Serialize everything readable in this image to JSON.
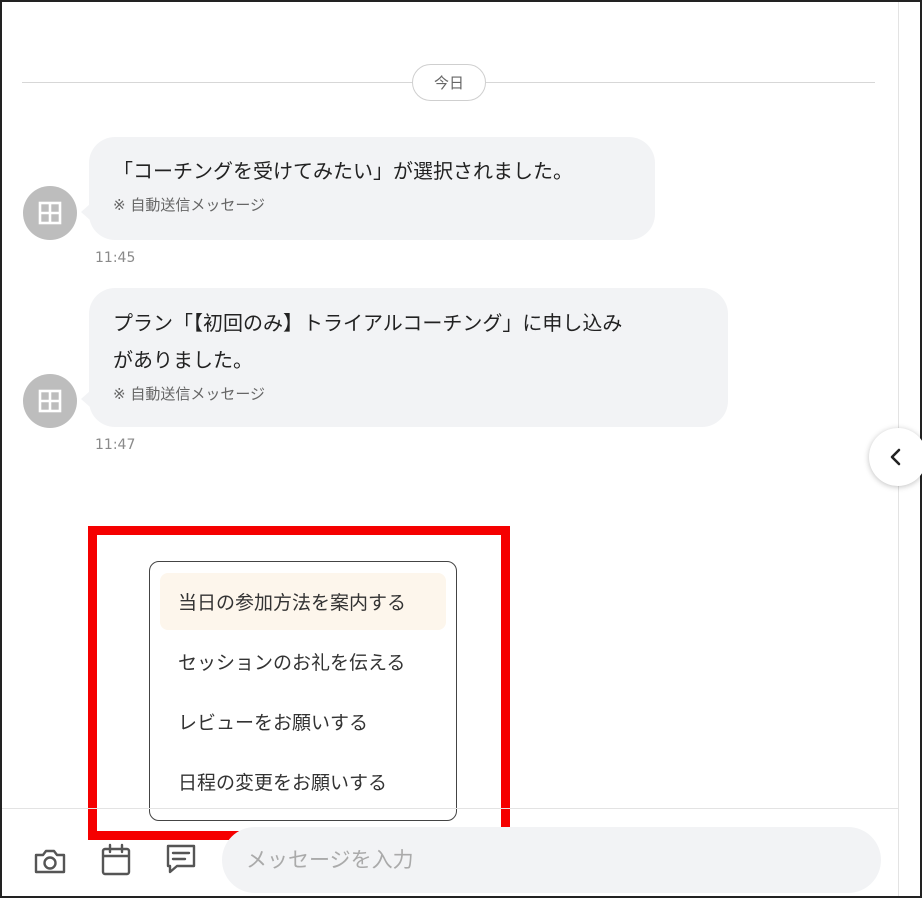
{
  "date_divider": {
    "label": "今日"
  },
  "messages": [
    {
      "text": "「コーチングを受けてみたい」が選択されました。",
      "note": "※ 自動送信メッセージ",
      "time": "11:45",
      "avatar_icon": "building-icon"
    },
    {
      "text": "プラン「【初回のみ】トライアルコーチング」に申し込み\nがありました。",
      "note": "※ 自動送信メッセージ",
      "time": "11:47",
      "avatar_icon": "building-icon"
    }
  ],
  "side_toggle": {
    "icon": "chevron-left-icon"
  },
  "template_menu": {
    "items": [
      {
        "label": "当日の参加方法を案内する",
        "active": true
      },
      {
        "label": "セッションのお礼を伝える",
        "active": false
      },
      {
        "label": "レビューをお願いする",
        "active": false
      },
      {
        "label": "日程の変更をお願いする",
        "active": false
      }
    ]
  },
  "composer": {
    "placeholder": "メッセージを入力",
    "icons": [
      "camera-icon",
      "calendar-icon",
      "message-template-icon"
    ]
  },
  "colors": {
    "highlight_border": "#f50000",
    "bubble_bg": "#f2f3f5",
    "avatar_bg": "#bdbdbd",
    "active_item_bg": "#fdf6ec"
  }
}
